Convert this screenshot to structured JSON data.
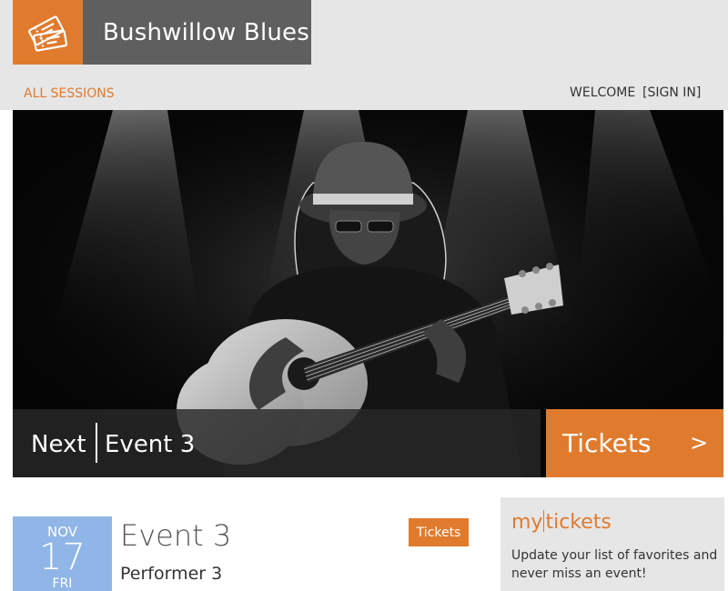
{
  "header": {
    "site_title": "Bushwillow Blues",
    "logo_icon": "tickets-icon"
  },
  "nav": {
    "all_sessions": "ALL SESSIONS",
    "welcome": "WELCOME",
    "sign_in": "[SIGN IN]"
  },
  "hero": {
    "image_icon": "guitarist-photo",
    "next_label": "Next",
    "next_event": "Event 3",
    "tickets_label": "Tickets",
    "tickets_arrow": ">"
  },
  "event": {
    "month": "NOV",
    "day": "17",
    "weekday": "FRI",
    "title": "Event 3",
    "performer": "Performer 3",
    "tickets_button": "Tickets"
  },
  "my_tickets": {
    "title_my": "my",
    "title_tickets": "tickets",
    "text": "Update your list of favorites and never miss an event!"
  },
  "colors": {
    "accent": "#e07b2e",
    "header_gray": "#5f5f5f",
    "band_gray": "#e6e6e6",
    "date_blue": "#8fb6e6"
  }
}
